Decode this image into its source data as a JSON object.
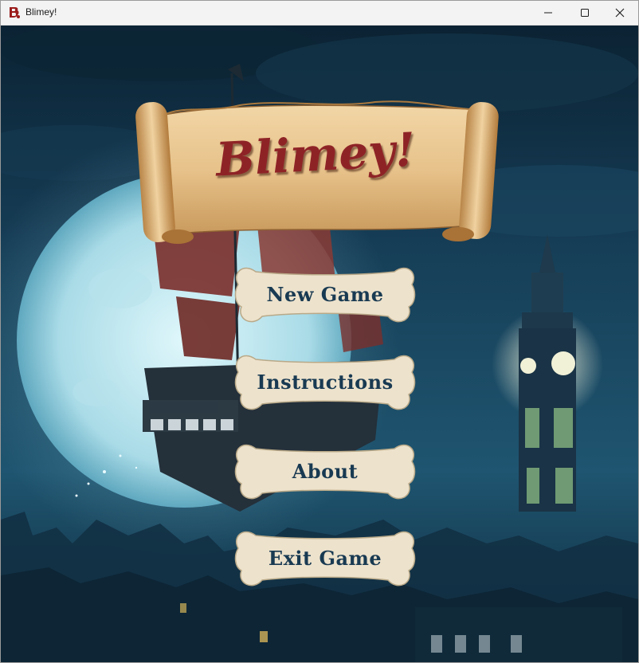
{
  "window": {
    "title": "Blimey!",
    "controls": {
      "minimize": "minimize-icon",
      "maximize": "maximize-icon",
      "close": "close-icon"
    }
  },
  "game": {
    "logo_text": "Blimey!",
    "menu": [
      {
        "label": "New Game"
      },
      {
        "label": "Instructions"
      },
      {
        "label": "About"
      },
      {
        "label": "Exit Game"
      }
    ]
  },
  "colors": {
    "sky_dark": "#0b2233",
    "sky_mid": "#1f5570",
    "moon": "#cfeff6",
    "title_red": "#8e2326",
    "button_text": "#193a52",
    "parchment": "#e9c791",
    "bone": "#ede2cc",
    "clock_glow": "#f3f3d8"
  }
}
